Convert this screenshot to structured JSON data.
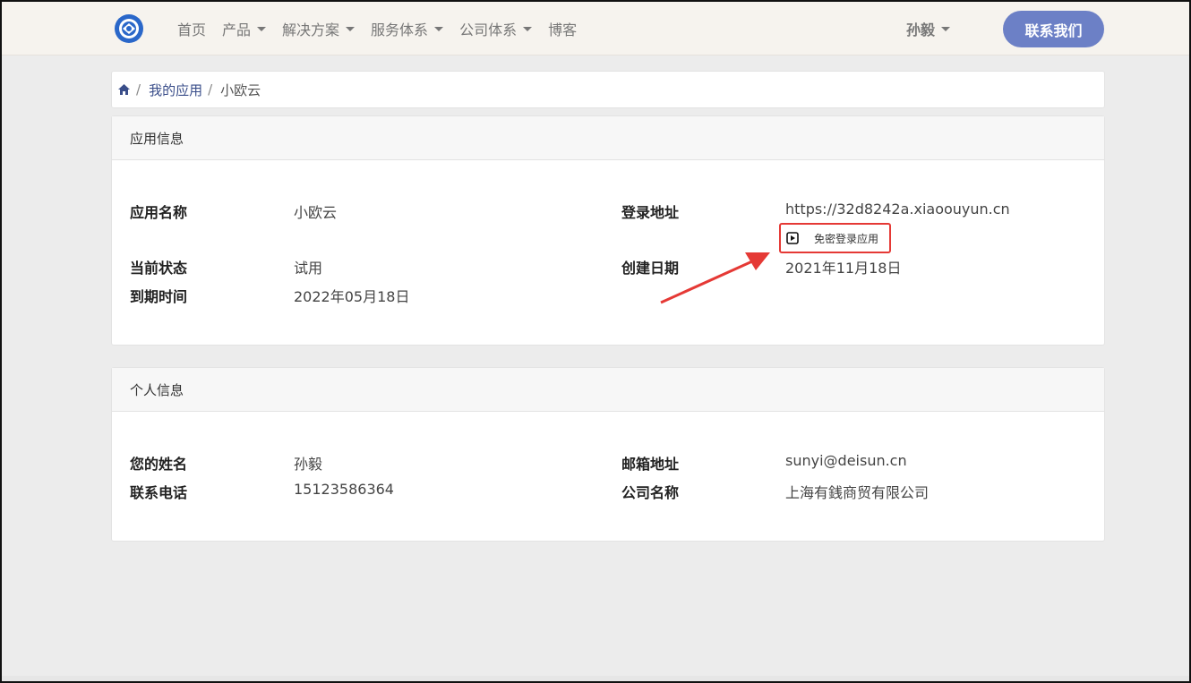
{
  "nav": {
    "items": [
      {
        "label": "首页",
        "dropdown": false
      },
      {
        "label": "产品",
        "dropdown": true
      },
      {
        "label": "解决方案",
        "dropdown": true
      },
      {
        "label": "服务体系",
        "dropdown": true
      },
      {
        "label": "公司体系",
        "dropdown": true
      },
      {
        "label": "博客",
        "dropdown": false
      }
    ],
    "user": "孙毅",
    "contact_label": "联系我们"
  },
  "breadcrumb": {
    "link": "我的应用",
    "current": "小欧云"
  },
  "app_info": {
    "title": "应用信息",
    "name_label": "应用名称",
    "name_value": "小欧云",
    "status_label": "当前状态",
    "status_value": "试用",
    "expire_label": "到期时间",
    "expire_value": "2022年05月18日",
    "login_label": "登录地址",
    "login_value": "https://32d8242a.xiaoouyun.cn",
    "free_login_label": "免密登录应用",
    "created_label": "创建日期",
    "created_value": "2021年11月18日"
  },
  "personal_info": {
    "title": "个人信息",
    "name_label": "您的姓名",
    "name_value": "孙毅",
    "phone_label": "联系电话",
    "phone_value": "15123586364",
    "email_label": "邮箱地址",
    "email_value": "sunyi@deisun.cn",
    "company_label": "公司名称",
    "company_value": "上海有銭商贸有限公司"
  },
  "colors": {
    "accent": "#6c80c6",
    "highlight": "#e53935",
    "link": "#3a4e8a"
  }
}
